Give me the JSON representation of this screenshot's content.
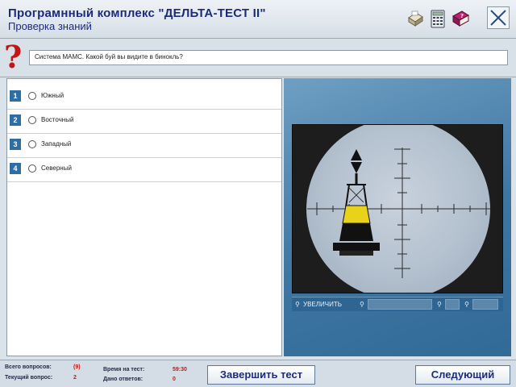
{
  "header": {
    "title": "Програмнный комплекс \"ДЕЛЬТА-ТЕСТ II\"",
    "subtitle": "Проверка знаний",
    "icons": [
      "printer-icon",
      "calculator-icon",
      "book-icon",
      "close-icon"
    ]
  },
  "question": {
    "text": "Система МАМС. Какой буй вы видите в бинокль?"
  },
  "answers": [
    {
      "num": "1",
      "label": "Южный"
    },
    {
      "num": "2",
      "label": "Восточный"
    },
    {
      "num": "3",
      "label": "Западный"
    },
    {
      "num": "4",
      "label": "Северный"
    }
  ],
  "image_toolbar": {
    "zoom_label": "УВЕЛИЧИТЬ"
  },
  "footer": {
    "total_questions_label": "Всего вопросов:",
    "total_questions_value": "(9)",
    "current_question_label": "Текущий вопрос:",
    "current_question_value": "2",
    "time_label": "Время на тест:",
    "time_value": "59:30",
    "answered_label": "Дано ответов:",
    "answered_value": "0",
    "finish_button": "Завершить тест",
    "next_button": "Следующий"
  },
  "colors": {
    "title_blue": "#1c2b7a",
    "panel_blue": "#3e76a2",
    "accent_red": "#c21616",
    "buoy_yellow": "#e8d21a"
  }
}
